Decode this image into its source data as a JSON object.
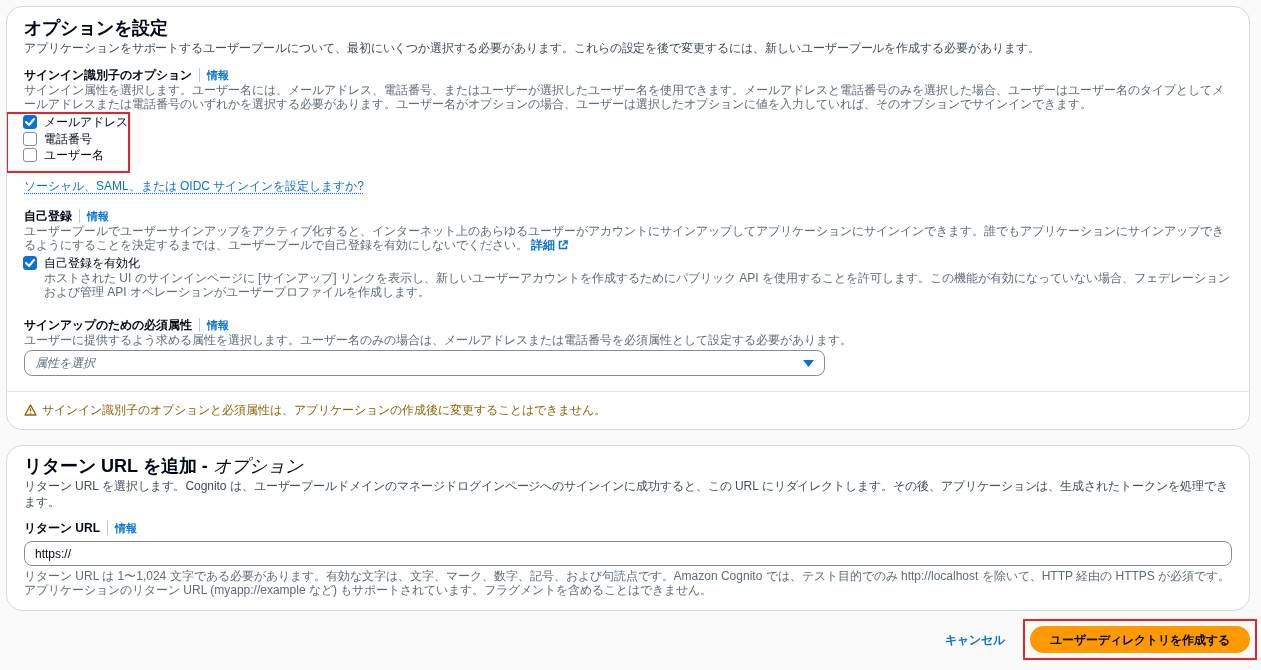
{
  "sections": [
    {
      "title": "オプションを設定",
      "description": "アプリケーションをサポートするユーザープールについて、最初にいくつか選択する必要があります。これらの設定を後で変更するには、新しいユーザープールを作成する必要があります。",
      "fields": [
        {
          "kind": "checkboxes",
          "label": "サインイン識別子のオプション",
          "info": "情報",
          "help": "サインイン属性を選択します。ユーザー名には、メールアドレス、電話番号、またはユーザーが選択したユーザー名を使用できます。メールアドレスと電話番号のみを選択した場合、ユーザーはユーザー名のタイプとしてメールアドレスまたは電話番号のいずれかを選択する必要があります。ユーザー名がオプションの場合、ユーザーは選択したオプションに値を入力していれば、そのオプションでサインインできます。",
          "highlighted": true,
          "options": [
            {
              "label": "メールアドレス",
              "checked": true
            },
            {
              "label": "電話番号",
              "checked": false
            },
            {
              "label": "ユーザー名",
              "checked": false
            }
          ]
        },
        {
          "kind": "link",
          "text": "ソーシャル、SAML、または OIDC サインインを設定しますか?"
        },
        {
          "kind": "checkboxes",
          "label": "自己登録",
          "info": "情報",
          "help": "ユーザープールでユーザーサインアップをアクティブ化すると、インターネット上のあらゆるユーザーがアカウントにサインアップしてアプリケーションにサインインできます。誰でもアプリケーションにサインアップできるようにすることを決定するまでは、ユーザープールで自己登録を有効にしないでください。",
          "help_link": "詳細",
          "highlighted": false,
          "options": [
            {
              "label": "自己登録を有効化",
              "checked": true,
              "description": "ホストされた UI のサインインページに [サインアップ] リンクを表示し、新しいユーザーアカウントを作成するためにパブリック API を使用することを許可します。この機能が有効になっていない場合、フェデレーションおよび管理 API オペレーションがユーザープロファイルを作成します。"
            }
          ]
        },
        {
          "kind": "select",
          "label": "サインアップのための必須属性",
          "info": "情報",
          "help": "ユーザーに提供するよう求める属性を選択します。ユーザー名のみの場合は、メールアドレスまたは電話番号を必須属性として設定する必要があります。",
          "placeholder": "属性を選択"
        }
      ],
      "warning": "サインイン識別子のオプションと必須属性は、アプリケーションの作成後に変更することはできません。"
    },
    {
      "title": "リターン URL を追加 - *オプション*",
      "description": "リターン URL を選択します。Cognito は、ユーザープールドメインのマネージドログインページへのサインインに成功すると、この URL にリダイレクトします。その後、アプリケーションは、生成されたトークンを処理できます。",
      "fields": [
        {
          "kind": "text_input",
          "label": "リターン URL",
          "info": "情報",
          "value": "https://",
          "help": "リターン URL は 1〜1,024 文字である必要があります。有効な文字は、文字、マーク、数字、記号、および句読点です。Amazon Cognito では、テスト目的でのみ http://localhost を除いて、HTTP 経由の HTTPS が必須です。アプリケーションのリターン URL (myapp://example など) もサポートされています。フラグメントを含めることはできません。"
        }
      ]
    }
  ],
  "footer": {
    "cancel": "キャンセル",
    "create_button": {
      "label": "ユーザーディレクトリを作成する",
      "highlighted": true
    }
  }
}
